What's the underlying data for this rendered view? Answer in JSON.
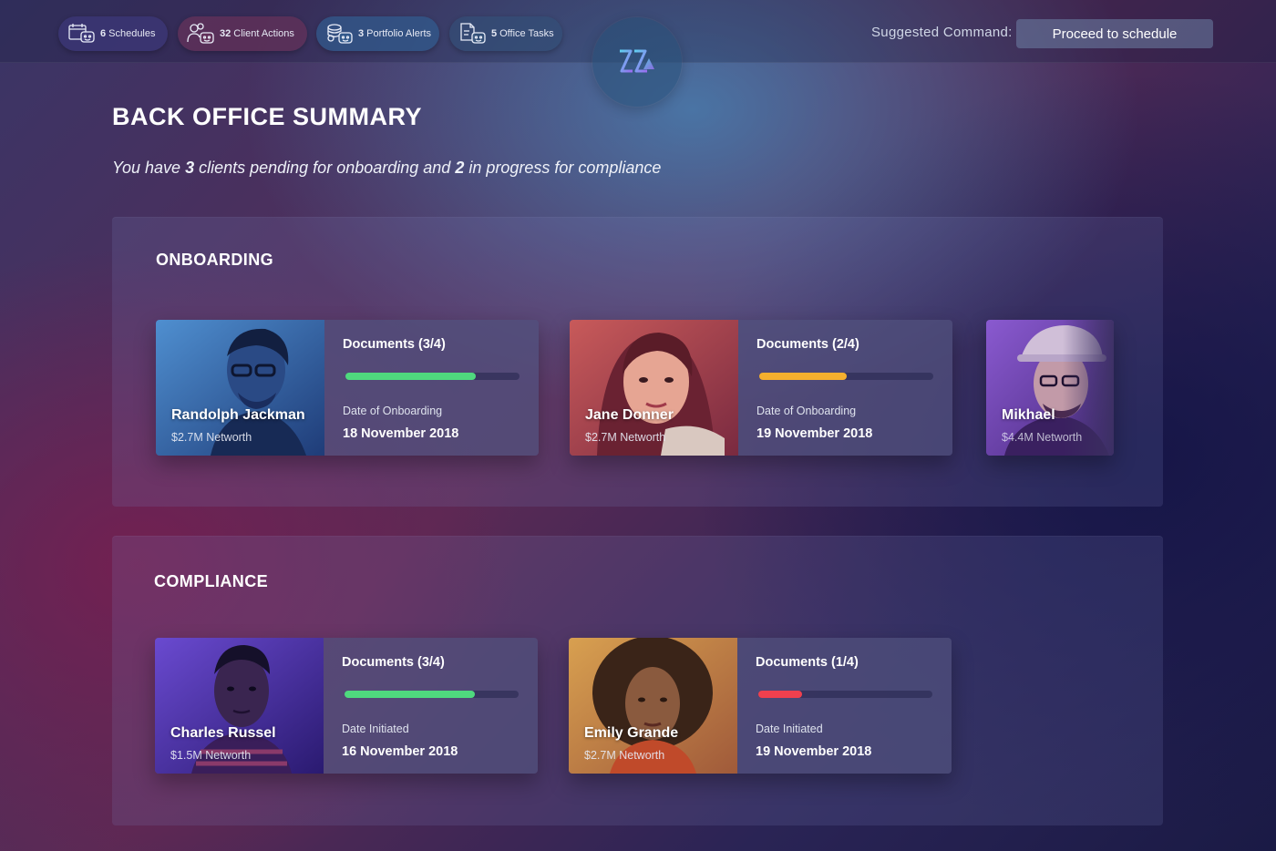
{
  "topbar": {
    "pills": [
      {
        "count": "6",
        "label": "Schedules",
        "icon": "calendar-robot-icon"
      },
      {
        "count": "32",
        "label": "Client Actions",
        "icon": "users-robot-icon"
      },
      {
        "count": "3",
        "label": "Portfolio Alerts",
        "icon": "coins-robot-icon"
      },
      {
        "count": "5",
        "label": "Office Tasks",
        "icon": "document-robot-icon"
      }
    ],
    "logo_icon": "zigzag-logo-icon",
    "suggested_label": "Suggested  Command:",
    "command_button": "Proceed to schedule"
  },
  "page": {
    "title": "BACK OFFICE SUMMARY",
    "summary_prefix": "You have ",
    "summary_pending": "3",
    "summary_middle": " clients pending for onboarding and ",
    "summary_progress": "2",
    "summary_suffix": " in progress for compliance"
  },
  "onboarding": {
    "title": "ONBOARDING",
    "cards": [
      {
        "name": "Randolph Jackman",
        "networth": "$2.7M Networth",
        "documents": "Documents (3/4)",
        "progress": 0.75,
        "bar_color": "#4fd97e",
        "date_label": "Date of Onboarding",
        "date": "18 November 2018"
      },
      {
        "name": "Jane Donner",
        "networth": "$2.7M Networth",
        "documents": "Documents (2/4)",
        "progress": 0.5,
        "bar_color": "#f5b02e",
        "date_label": "Date of Onboarding",
        "date": "19 November 2018"
      },
      {
        "name": "Mikhael",
        "networth": "$4.4M Networth"
      }
    ]
  },
  "compliance": {
    "title": "COMPLIANCE",
    "cards": [
      {
        "name": "Charles Russel",
        "networth": "$1.5M Networth",
        "documents": "Documents (3/4)",
        "progress": 0.75,
        "bar_color": "#4fd97e",
        "date_label": "Date Initiated",
        "date": "16 November 2018"
      },
      {
        "name": "Emily Grande",
        "networth": "$2.7M Networth",
        "documents": "Documents (1/4)",
        "progress": 0.25,
        "bar_color": "#f0404e",
        "date_label": "Date Initiated",
        "date": "19 November 2018"
      }
    ]
  }
}
